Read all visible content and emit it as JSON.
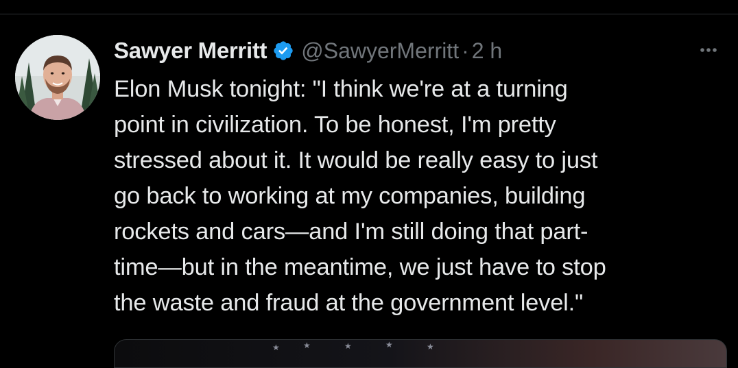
{
  "tweet": {
    "author": {
      "display_name": "Sawyer Merritt",
      "handle": "@SawyerMerritt",
      "verified": true,
      "verified_color": "#1d9bf0"
    },
    "separator": "·",
    "timestamp": "2 h",
    "more_icon": "more-horizontal-icon",
    "text": "Elon Musk tonight: \"I think we're at a turning\npoint in civilization. To be honest, I'm pretty\nstressed about it. It would be really easy to just\ngo back to working at my companies, building\nrockets and cars—and I'm still doing that part-\ntime—but in the meantime, we just have to stop\nthe waste and fraud at the government level.\""
  },
  "colors": {
    "background": "#000000",
    "text_primary": "#e7e9ea",
    "text_secondary": "#71767b",
    "divider": "#2f3336"
  }
}
